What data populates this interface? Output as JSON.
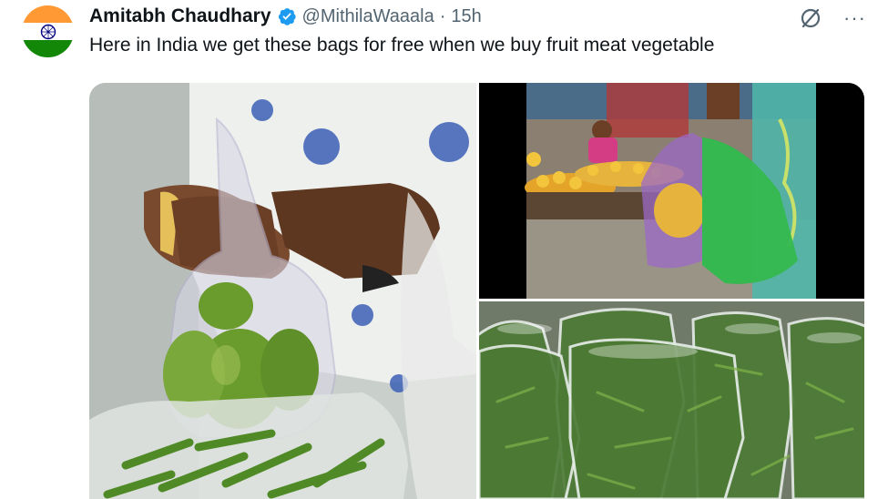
{
  "tweet": {
    "author_name": "Amitabh Chaudhary",
    "handle": "@MithilaWaaala",
    "separator": "·",
    "time": "15h",
    "text": "Here in India we get these bags for free when we buy fruit meat vegetable",
    "more_label": "···"
  },
  "avatar": {
    "flag": "india-flag",
    "colors": {
      "saffron": "#ff9933",
      "white": "#ffffff",
      "green": "#138808",
      "chakra": "#000080"
    }
  },
  "icons": {
    "verified": "verified-badge-icon",
    "grok": "grok-icon",
    "more": "more-options-icon"
  },
  "colors": {
    "verified_blue": "#1d9bf0",
    "secondary_text": "#536471",
    "primary_text": "#0f1419"
  },
  "media": {
    "images": [
      {
        "name": "hand-tying-plastic-bag-with-mangoes-photo"
      },
      {
        "name": "fruit-vendor-plastic-bags-photo"
      },
      {
        "name": "green-chillies-in-plastic-bags-photo"
      }
    ]
  }
}
